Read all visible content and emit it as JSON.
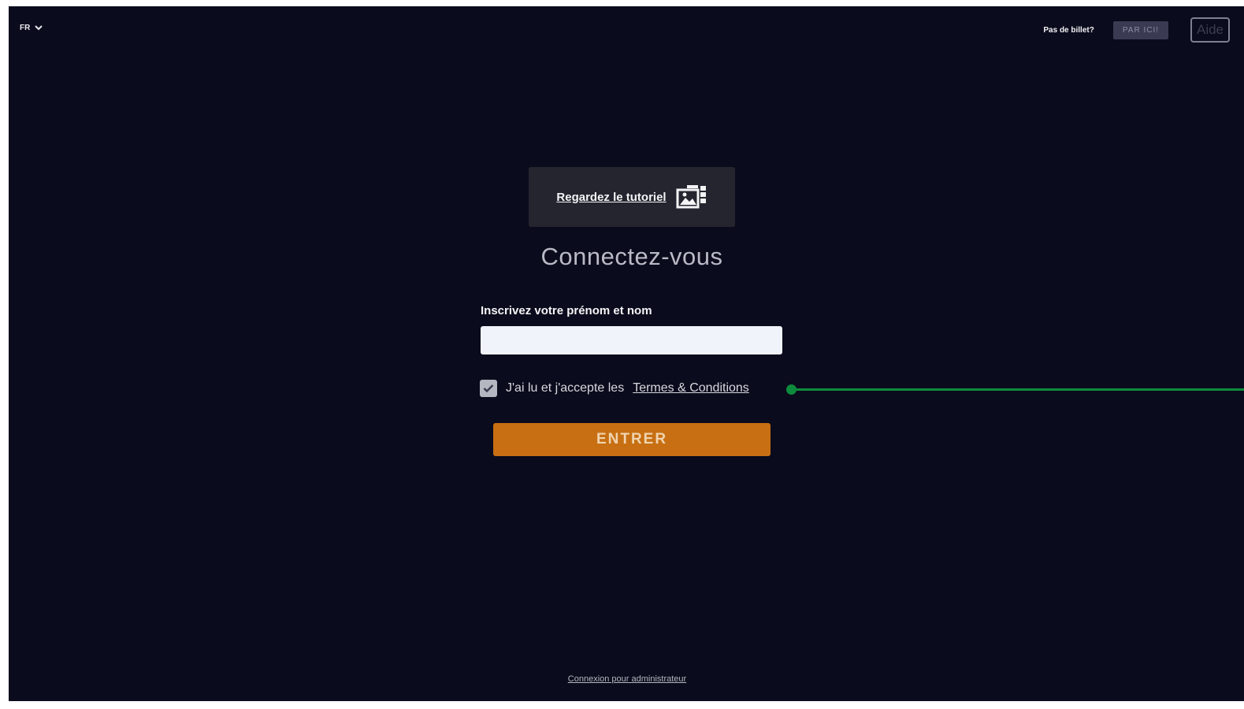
{
  "header": {
    "language": "FR",
    "no_ticket_text": "Pas de billet?",
    "par_ici_label": "PAR ICI!",
    "aide_label": "Aide"
  },
  "tutorial": {
    "label": "Regardez le tutoriel",
    "icon": "gallery-icon"
  },
  "login": {
    "title": "Connectez-vous",
    "name_label": "Inscrivez votre prénom et nom",
    "name_value": "",
    "terms_checked": true,
    "terms_text": "J'ai lu et j'accepte les",
    "terms_link": "Termes & Conditions",
    "enter_label": "ENTRER"
  },
  "footer": {
    "admin_link": "Connexion pour administrateur"
  },
  "colors": {
    "background": "#0a0b1c",
    "accent": "#c76f12",
    "pointer": "#0d8b3c"
  }
}
